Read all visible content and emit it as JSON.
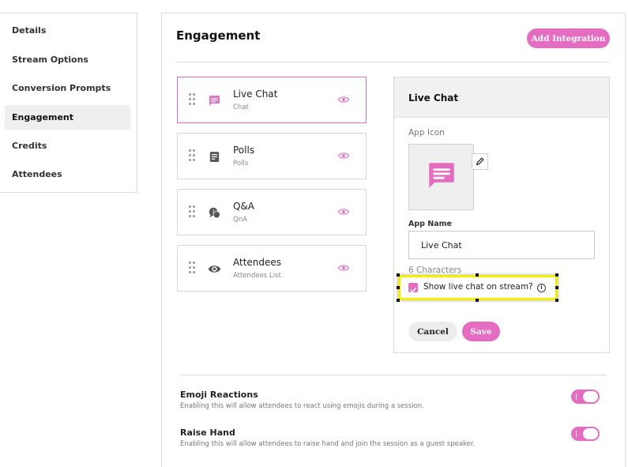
{
  "nav": {
    "items": [
      {
        "label": "Details"
      },
      {
        "label": "Stream Options"
      },
      {
        "label": "Conversion Prompts"
      },
      {
        "label": "Engagement"
      },
      {
        "label": "Credits"
      },
      {
        "label": "Attendees"
      }
    ],
    "active": "Engagement"
  },
  "header": {
    "title": "Engagement",
    "add_button": "Add Integration"
  },
  "integrations": [
    {
      "title": "Live Chat",
      "subtitle": "Chat",
      "icon": "chat-icon"
    },
    {
      "title": "Polls",
      "subtitle": "Polls",
      "icon": "poll-icon"
    },
    {
      "title": "Q&A",
      "subtitle": "QnA",
      "icon": "qna-icon"
    },
    {
      "title": "Attendees",
      "subtitle": "Attendees List",
      "icon": "eye-icon"
    }
  ],
  "detail": {
    "title": "Live Chat",
    "app_icon_label": "App Icon",
    "app_name_label": "App Name",
    "app_name_value": "Live Chat",
    "char_count": "6 Characters",
    "checkbox_label": "Show live chat on stream?",
    "checkbox_checked": true,
    "cancel_label": "Cancel",
    "save_label": "Save"
  },
  "settings": [
    {
      "title": "Emoji Reactions",
      "description": "Enabling this will allow attendees to react using emojis during a session.",
      "enabled": true
    },
    {
      "title": "Raise Hand",
      "description": "Enabling this will allow attendees to raise hand and join the session as a guest speaker.",
      "enabled": true
    }
  ],
  "colors": {
    "accent": "#e46cc1",
    "highlight": "#f2ef00"
  }
}
